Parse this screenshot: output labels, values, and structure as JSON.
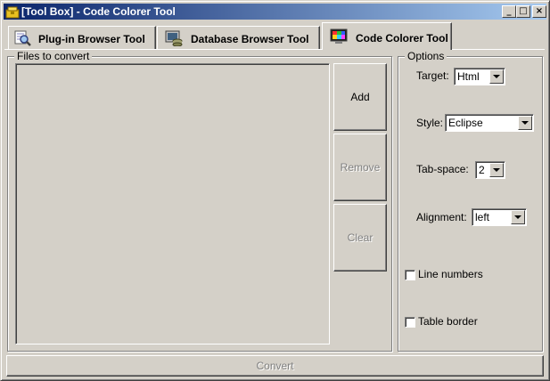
{
  "window": {
    "title": "[Tool Box] - Code Colorer Tool",
    "minimize": "_",
    "maximize": "□",
    "close": "×"
  },
  "tabs": [
    {
      "label": "Plug-in Browser Tool",
      "icon": "magnifier-icon"
    },
    {
      "label": "Database Browser Tool",
      "icon": "database-icon"
    },
    {
      "label": "Code Colorer Tool",
      "icon": "color-palette-icon",
      "active": true
    }
  ],
  "files": {
    "group_label": "Files to convert",
    "items": [],
    "add_label": "Add",
    "remove_label": "Remove",
    "clear_label": "Clear"
  },
  "options": {
    "group_label": "Options",
    "target_label": "Target:",
    "target_value": "Html",
    "style_label": "Style:",
    "style_value": "Eclipse",
    "tabspace_label": "Tab-space:",
    "tabspace_value": "2",
    "alignment_label": "Alignment:",
    "alignment_value": "left",
    "line_numbers_label": "Line numbers",
    "line_numbers_checked": false,
    "table_border_label": "Table border",
    "table_border_checked": false
  },
  "convert_label": "Convert",
  "colors": {
    "face": "#d4d0c8",
    "title_start": "#0a246a",
    "title_end": "#a6caf0",
    "disabled_text": "#808080"
  }
}
